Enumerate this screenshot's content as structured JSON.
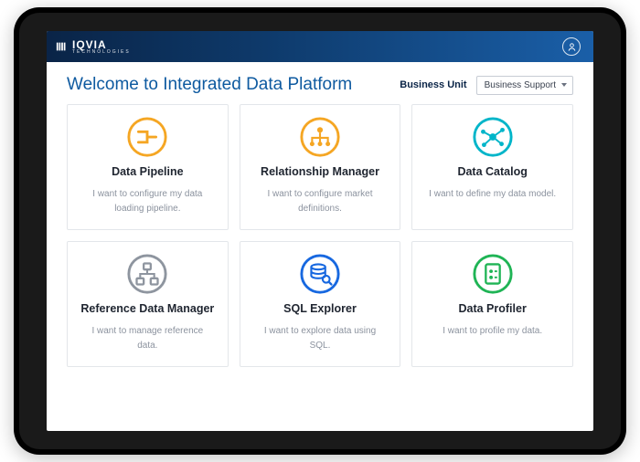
{
  "brand": {
    "main": "IQVIA",
    "sub": "TECHNOLOGIES"
  },
  "page_title": "Welcome to Integrated Data Platform",
  "business_unit": {
    "label": "Business Unit",
    "selected": "Business Support"
  },
  "cards": [
    {
      "icon": "pipeline",
      "color": "#f5a623",
      "title": "Data Pipeline",
      "desc": "I want to configure my data loading pipeline."
    },
    {
      "icon": "org",
      "color": "#f5a623",
      "title": "Relationship Manager",
      "desc": "I want to configure market definitions."
    },
    {
      "icon": "network",
      "color": "#00b5c9",
      "title": "Data Catalog",
      "desc": "I want to define my data model."
    },
    {
      "icon": "hierarchy",
      "color": "#8e959f",
      "title": "Reference Data Manager",
      "desc": "I want to manage reference data."
    },
    {
      "icon": "sql",
      "color": "#1768e0",
      "title": "SQL Explorer",
      "desc": "I want to explore data using SQL."
    },
    {
      "icon": "profiler",
      "color": "#1fb455",
      "title": "Data Profiler",
      "desc": "I want to profile my data."
    }
  ]
}
